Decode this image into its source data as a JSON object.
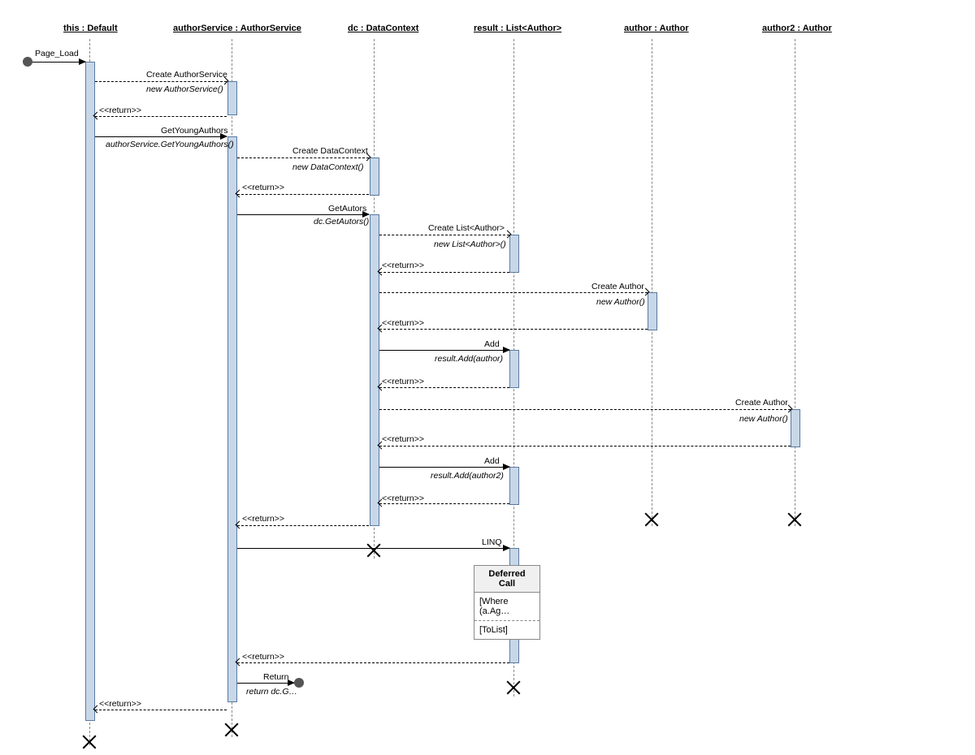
{
  "participants": {
    "p1": "this :   Default",
    "p2": "authorService : AuthorService",
    "p3": "dc : DataContext",
    "p4": "result : List<Author>",
    "p5": "author : Author",
    "p6": "author2 : Author"
  },
  "labels": {
    "page_load": "Page_Load",
    "create_authorservice": "Create AuthorService",
    "new_authorservice": "new AuthorService()",
    "return": "<<return>>",
    "get_young_authors": "GetYoungAuthors",
    "get_young_authors_call": "authorService.GetYoungAuthors()",
    "create_datacontext": "Create DataContext",
    "new_datacontext": "new DataContext()",
    "get_autors": "GetAutors",
    "dc_getautors": "dc.GetAutors()",
    "create_list_author": "Create List<Author>",
    "new_list_author": "new List<Author>()",
    "create_author": "Create Author",
    "new_author": "new Author()",
    "add": "Add",
    "result_add_author": "result.Add(author)",
    "result_add_author2": "result.Add(author2)",
    "linq": "LINQ",
    "return_word": "Return",
    "return_dc": "return dc.G…",
    "deferred_title": "Deferred Call",
    "deferred_where": "[Where (a.Ag…",
    "deferred_tolist": "[ToList]"
  }
}
